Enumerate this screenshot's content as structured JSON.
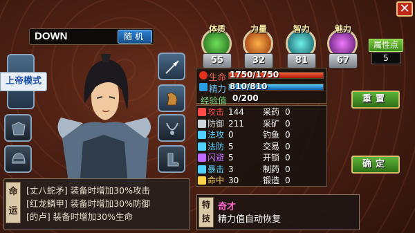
{
  "header": {
    "close_label": "✕"
  },
  "player": {
    "name": "DOWN",
    "random_label": "随机"
  },
  "mode_badge": "上帝模式",
  "attributes": [
    {
      "label": "体质",
      "value": "55",
      "color": "#3aa832"
    },
    {
      "label": "力量",
      "value": "32",
      "color": "#e0601e"
    },
    {
      "label": "智力",
      "value": "81",
      "color": "#2ab8b0"
    },
    {
      "label": "魅力",
      "value": "67",
      "color": "#b02ad0"
    }
  ],
  "attribute_points": {
    "label": "属性点",
    "value": "5"
  },
  "bars": {
    "life": {
      "label": "生命",
      "value": "1750/1750",
      "fill": 1.0,
      "color": "#e0321e"
    },
    "energy": {
      "label": "精力",
      "value": "810/810",
      "fill": 1.0,
      "color": "#2a9ce0"
    },
    "exp": {
      "label": "经验值",
      "value": "0/200",
      "fill": 0.0
    }
  },
  "combat_stats": [
    {
      "label": "攻击",
      "value": "144",
      "color": "#ff4a4a"
    },
    {
      "label": "防御",
      "value": "211",
      "color": "#cfd6dc"
    },
    {
      "label": "法攻",
      "value": "0",
      "color": "#4fd0ff"
    },
    {
      "label": "法防",
      "value": "5",
      "color": "#4fd0ff"
    },
    {
      "label": "闪避",
      "value": "5",
      "color": "#c069ff"
    },
    {
      "label": "暴击",
      "value": "3",
      "color": "#4fd0ff"
    },
    {
      "label": "命中",
      "value": "30",
      "color": "#ffd24a"
    }
  ],
  "life_skills": [
    {
      "label": "采药",
      "value": "0"
    },
    {
      "label": "采矿",
      "value": "0"
    },
    {
      "label": "钓鱼",
      "value": "0"
    },
    {
      "label": "交易",
      "value": "0"
    },
    {
      "label": "开锁",
      "value": "0"
    },
    {
      "label": "制药",
      "value": "0"
    },
    {
      "label": "锻造",
      "value": "0"
    }
  ],
  "buttons": {
    "reset": "重置",
    "confirm": "确定"
  },
  "fate": {
    "label": "命运",
    "items": [
      "[丈八蛇矛] 装备时增加30%攻击",
      "[红龙鳞甲] 装备时增加30%防御",
      "[的卢] 装备时增加30%生命"
    ]
  },
  "special_skill": {
    "label": "特技",
    "name": "奇才",
    "desc": "精力值自动恢复"
  },
  "colors": {
    "accent_green": "#5fb33a",
    "life_red": "#e0321e",
    "energy_blue": "#2a9ce0"
  }
}
